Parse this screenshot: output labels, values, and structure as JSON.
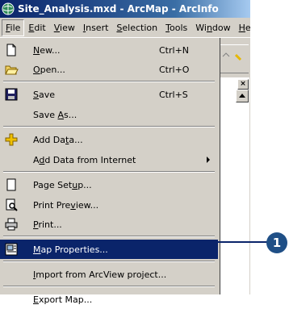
{
  "window": {
    "title": "Site_Analysis.mxd - ArcMap - ArcInfo"
  },
  "menubar": {
    "items": [
      {
        "first": "F",
        "rest": "ile"
      },
      {
        "first": "E",
        "rest": "dit"
      },
      {
        "first": "V",
        "rest": "iew"
      },
      {
        "first": "I",
        "rest": "nsert"
      },
      {
        "first": "S",
        "rest": "election"
      },
      {
        "first": "T",
        "rest": "ools"
      },
      {
        "pre": "Wi",
        "mid": "n",
        "rest": "dow"
      },
      {
        "first": "H",
        "rest": "e"
      }
    ]
  },
  "file_menu": {
    "items": [
      {
        "label_u": "N",
        "label_rest": "ew...",
        "shortcut": "Ctrl+N",
        "icon": "new-document-icon"
      },
      {
        "label_u": "O",
        "label_rest": "pen...",
        "shortcut": "Ctrl+O",
        "icon": "open-folder-icon"
      },
      {
        "label_u": "S",
        "label_rest": "ave",
        "shortcut": "Ctrl+S",
        "icon": "save-disk-icon"
      },
      {
        "label_pre": "Save ",
        "label_u": "A",
        "label_rest": "s...",
        "shortcut": ""
      },
      {
        "label_pre": "Add Da",
        "label_u": "t",
        "label_rest": "a...",
        "icon": "add-data-icon"
      },
      {
        "label_pre": "A",
        "label_u": "d",
        "label_rest": "d Data from Internet",
        "submenu": true
      },
      {
        "label_pre": "Page Set",
        "label_u": "u",
        "label_rest": "p...",
        "icon": "page-setup-icon"
      },
      {
        "label_pre": "Print Pre",
        "label_u": "v",
        "label_rest": "iew...",
        "icon": "print-preview-icon"
      },
      {
        "label_u": "P",
        "label_rest": "rint...",
        "icon": "printer-icon"
      },
      {
        "label_u": "M",
        "label_rest": "ap Properties...",
        "icon": "map-properties-icon",
        "selected": true
      },
      {
        "label_u": "I",
        "label_rest": "mport from ArcView project..."
      },
      {
        "label_u": "E",
        "label_rest": "xport Map..."
      }
    ]
  },
  "callout": {
    "number": "1"
  },
  "colors": {
    "menu_bg": "#d4d0c8",
    "selection": "#0a246a",
    "callout": "#1f4f86"
  }
}
